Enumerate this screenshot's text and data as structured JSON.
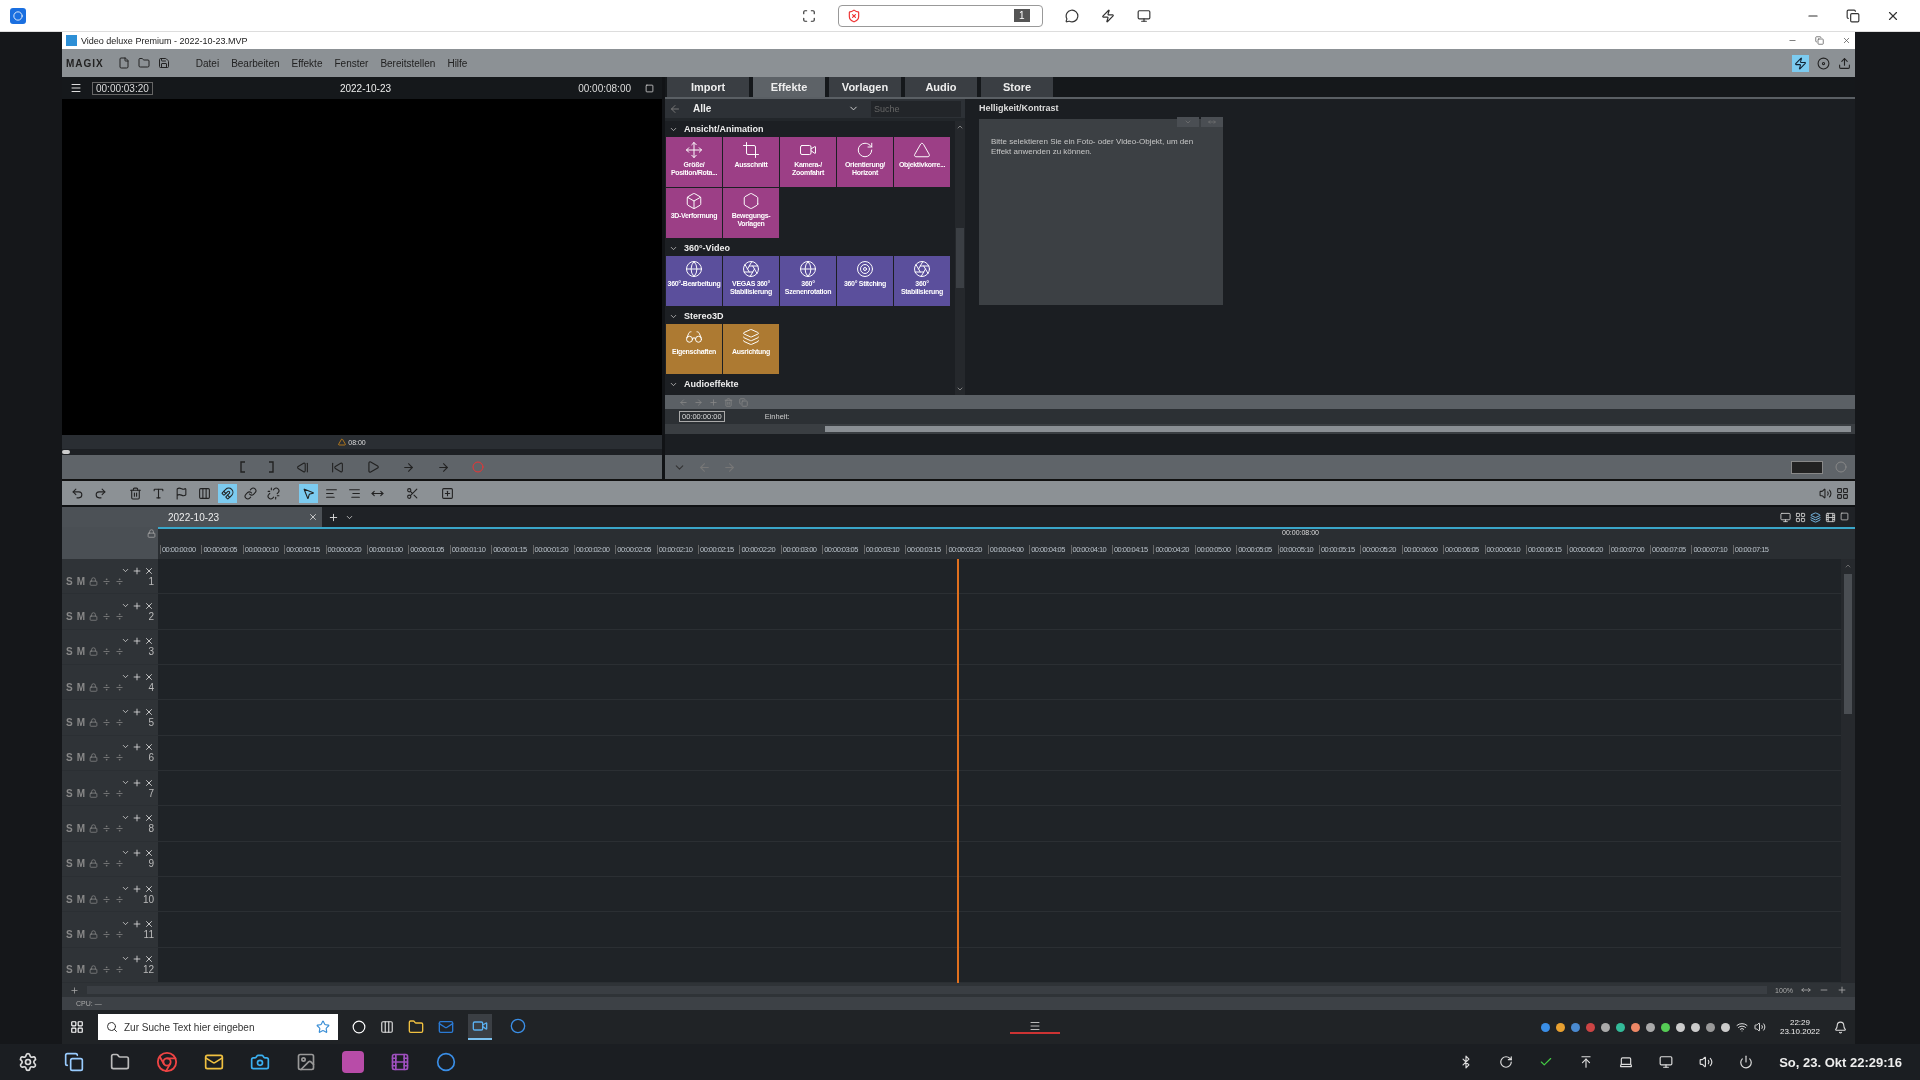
{
  "host_toolbar": {
    "counter": "1"
  },
  "window": {
    "title": "Video deluxe Premium - 2022-10-23.MVP"
  },
  "brand": "MAGIX",
  "menu": [
    "Datei",
    "Bearbeiten",
    "Effekte",
    "Fenster",
    "Bereitstellen",
    "Hilfe"
  ],
  "preview": {
    "timecode": "00:00:03:20",
    "title": "2022-10-23",
    "duration": "00:00:08:00",
    "marker": "08:00",
    "position": {
      "level": 0
    }
  },
  "media_tabs": [
    {
      "label": "Import",
      "selected": false
    },
    {
      "label": "Effekte",
      "selected": true
    },
    {
      "label": "Vorlagen",
      "selected": false
    },
    {
      "label": "Audio",
      "selected": false
    },
    {
      "label": "Store",
      "selected": false
    }
  ],
  "effects": {
    "category": "Alle",
    "search_placeholder": "Suche",
    "groups": [
      {
        "title": "Ansicht/Animation",
        "expanded": true,
        "color": "#9c3f86",
        "tiles": [
          "Größe/ Position/Rota...",
          "Ausschnitt",
          "Kamera-/ Zoomfahrt",
          "Orientierung/ Horizont",
          "Objektivkorre...",
          "3D-Verformung",
          "Bewegungs-Vorlagen"
        ]
      },
      {
        "title": "360°-Video",
        "expanded": true,
        "color": "#5b4f9c",
        "tiles": [
          "360°-Bearbeitung",
          "VEGAS 360° Stabilisierung",
          "360° Szenenrotation",
          "360° Stitching",
          "360° Stabilisierung"
        ]
      },
      {
        "title": "Stereo3D",
        "expanded": true,
        "color": "#ad7a32",
        "tiles": [
          "Eigenschaften",
          "Ausrichtung"
        ]
      },
      {
        "title": "Audioeffekte",
        "expanded": true
      }
    ]
  },
  "properties": {
    "title": "Helligkeit/Kontrast",
    "message": "Bitte selektieren Sie ein Foto- oder Video-Objekt, um den Effekt anwenden zu können."
  },
  "keyframes": {
    "timecode": "00:00:00:00",
    "unit_label": "Einheit:"
  },
  "toolbar": [
    {
      "kind": "undo",
      "selected": false
    },
    {
      "kind": "redo",
      "selected": false
    },
    {
      "kind": "delete",
      "selected": false
    },
    {
      "kind": "text",
      "selected": false
    },
    {
      "kind": "marker",
      "selected": false
    },
    {
      "kind": "split",
      "selected": false
    },
    {
      "kind": "magnet",
      "selected": true
    },
    {
      "kind": "link",
      "selected": false
    },
    {
      "kind": "unlink",
      "selected": false
    },
    {
      "kind": "pointer",
      "selected": true
    },
    {
      "kind": "pointer-group",
      "selected": false
    },
    {
      "kind": "pointer-track",
      "selected": false
    },
    {
      "kind": "stretch",
      "selected": false
    },
    {
      "kind": "cut",
      "selected": false
    },
    {
      "kind": "insert",
      "selected": false
    }
  ],
  "timeline": {
    "tab": "2022-10-23",
    "end_marker": "00:00:08:00",
    "ruler": [
      "00:00:00:00",
      "00:00:00:05",
      "00:00:00:10",
      "00:00:00:15",
      "00:00:00:20",
      "00:00:01:00",
      "00:00:01:05",
      "00:00:01:10",
      "00:00:01:15",
      "00:00:01:20",
      "00:00:02:00",
      "00:00:02:05",
      "00:00:02:10",
      "00:00:02:15",
      "00:00:02:20",
      "00:00:03:00",
      "00:00:03:05",
      "00:00:03:10",
      "00:00:03:15",
      "00:00:03:20",
      "00:00:04:00",
      "00:00:04:05",
      "00:00:04:10",
      "00:00:04:15",
      "00:00:04:20",
      "00:00:05:00",
      "00:00:05:05",
      "00:00:05:10",
      "00:00:05:15",
      "00:00:05:20",
      "00:00:06:00",
      "00:00:06:05",
      "00:00:06:10",
      "00:00:06:15",
      "00:00:06:20",
      "00:00:07:00",
      "00:00:07:05",
      "00:00:07:10",
      "00:00:07:15"
    ],
    "tracks": [
      {
        "solo": "S",
        "mute": "M",
        "number": "1"
      },
      {
        "solo": "S",
        "mute": "M",
        "number": "2"
      },
      {
        "solo": "S",
        "mute": "M",
        "number": "3"
      },
      {
        "solo": "S",
        "mute": "M",
        "number": "4"
      },
      {
        "solo": "S",
        "mute": "M",
        "number": "5"
      },
      {
        "solo": "S",
        "mute": "M",
        "number": "6"
      },
      {
        "solo": "S",
        "mute": "M",
        "number": "7"
      },
      {
        "solo": "S",
        "mute": "M",
        "number": "8"
      },
      {
        "solo": "S",
        "mute": "M",
        "number": "9"
      },
      {
        "solo": "S",
        "mute": "M",
        "number": "10"
      },
      {
        "solo": "S",
        "mute": "M",
        "number": "11"
      },
      {
        "solo": "S",
        "mute": "M",
        "number": "12"
      }
    ],
    "zoom": "100%"
  },
  "status_bar": "CPU: —",
  "taskbar": {
    "search_placeholder": "Zur Suche Text hier eingeben",
    "time": "22:29",
    "date": "23.10.2022"
  },
  "dock": {
    "datetime": "So, 23. Okt  22:29:16"
  }
}
